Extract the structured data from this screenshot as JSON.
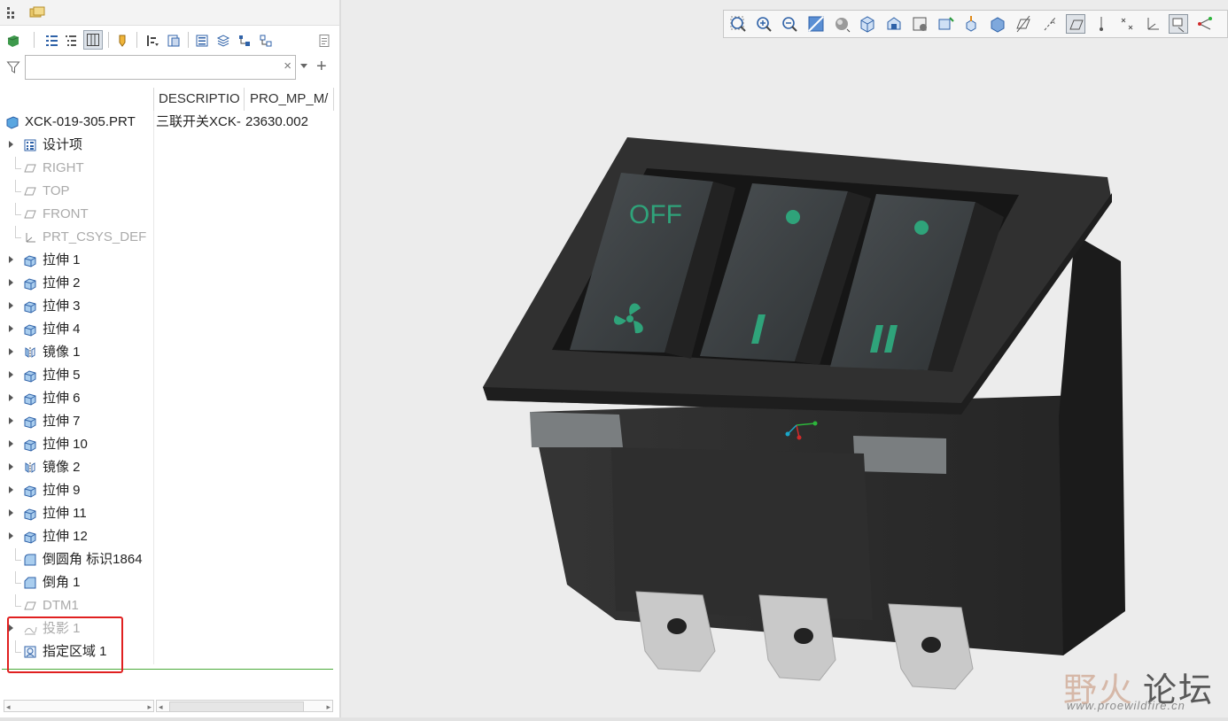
{
  "tree": {
    "columns": [
      "DESCRIPTIO",
      "PRO_MP_M/"
    ],
    "root": {
      "label": "XCK-019-305.PRT",
      "description": "三联开关XCK-",
      "mp": "23630.002"
    },
    "items": [
      {
        "label": "设计项",
        "icon": "design-items-icon",
        "expand": true,
        "gray": false
      },
      {
        "label": "RIGHT",
        "icon": "datum-plane-icon",
        "expand": false,
        "gray": true
      },
      {
        "label": "TOP",
        "icon": "datum-plane-icon",
        "expand": false,
        "gray": true
      },
      {
        "label": "FRONT",
        "icon": "datum-plane-icon",
        "expand": false,
        "gray": true
      },
      {
        "label": "PRT_CSYS_DEF",
        "icon": "csys-icon",
        "expand": false,
        "gray": true
      },
      {
        "label": "拉伸 1",
        "icon": "extrude-icon",
        "expand": true,
        "gray": false
      },
      {
        "label": "拉伸 2",
        "icon": "extrude-icon",
        "expand": true,
        "gray": false
      },
      {
        "label": "拉伸 3",
        "icon": "extrude-icon",
        "expand": true,
        "gray": false
      },
      {
        "label": "拉伸 4",
        "icon": "extrude-icon",
        "expand": true,
        "gray": false
      },
      {
        "label": "镜像 1",
        "icon": "mirror-icon",
        "expand": true,
        "gray": false
      },
      {
        "label": "拉伸 5",
        "icon": "extrude-icon",
        "expand": true,
        "gray": false
      },
      {
        "label": "拉伸 6",
        "icon": "extrude-icon",
        "expand": true,
        "gray": false
      },
      {
        "label": "拉伸 7",
        "icon": "extrude-icon",
        "expand": true,
        "gray": false
      },
      {
        "label": "拉伸 10",
        "icon": "extrude-icon",
        "expand": true,
        "gray": false
      },
      {
        "label": "镜像 2",
        "icon": "mirror-icon",
        "expand": true,
        "gray": false
      },
      {
        "label": "拉伸 9",
        "icon": "extrude-icon",
        "expand": true,
        "gray": false
      },
      {
        "label": "拉伸 11",
        "icon": "extrude-icon",
        "expand": true,
        "gray": false
      },
      {
        "label": "拉伸 12",
        "icon": "extrude-icon",
        "expand": true,
        "gray": false
      },
      {
        "label": "倒圆角 标识1864",
        "icon": "round-icon",
        "expand": false,
        "gray": false
      },
      {
        "label": "倒角 1",
        "icon": "chamfer-icon",
        "expand": false,
        "gray": false
      },
      {
        "label": "DTM1",
        "icon": "datum-plane-icon",
        "expand": false,
        "gray": true
      },
      {
        "label": "投影 1",
        "icon": "project-curve-icon",
        "expand": true,
        "gray": true
      },
      {
        "label": "指定区域 1",
        "icon": "designate-area-icon",
        "expand": false,
        "gray": false
      }
    ]
  },
  "model": {
    "switch1_top": "OFF",
    "switch2_bottom": "I",
    "switch3_bottom": "II"
  },
  "watermark": {
    "cn_part1": "野火",
    "cn_part2": "论坛",
    "url": "www.proewildfire.cn"
  },
  "colors": {
    "model_body": "#2c2c2c",
    "rocker_green": "#2fa37a",
    "highlight_red": "#e02020"
  }
}
